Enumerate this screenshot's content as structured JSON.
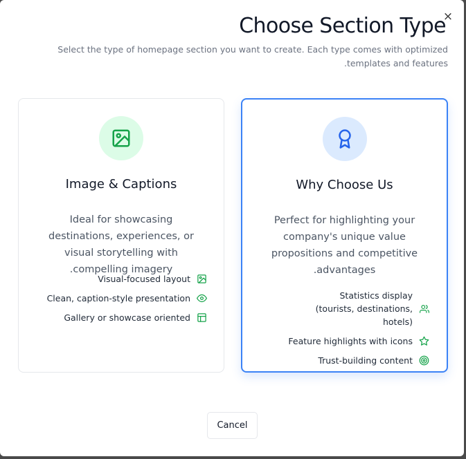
{
  "dialog": {
    "close_glyph": "×",
    "title": "Choose Section Type",
    "subtitle": "Select the type of homepage section you want to create. Each type comes with optimized templates and features."
  },
  "cards": [
    {
      "id": "image-captions",
      "icon": "image-icon",
      "accent": "#16a34a",
      "title": "Image & Captions",
      "description": "Ideal for showcasing destinations, experiences, or visual storytelling with compelling imagery.",
      "features": [
        {
          "label": "Visual-focused layout",
          "icon": "image-icon"
        },
        {
          "label": "Clean, caption-style presentation",
          "icon": "eye-icon"
        },
        {
          "label": "Gallery or showcase oriented",
          "icon": "layout-icon"
        }
      ]
    },
    {
      "id": "why-choose-us",
      "icon": "award-icon",
      "accent": "#2563eb",
      "selected": true,
      "title": "Why Choose Us",
      "description": "Perfect for highlighting your company's unique value propositions and competitive advantages.",
      "features": [
        {
          "label": "Statistics display (tourists, destinations, hotels)",
          "icon": "users-icon"
        },
        {
          "label": "Feature highlights with icons",
          "icon": "star-icon"
        },
        {
          "label": "Trust-building content",
          "icon": "target-icon"
        }
      ]
    }
  ],
  "footer": {
    "cancel_label": "Cancel"
  }
}
